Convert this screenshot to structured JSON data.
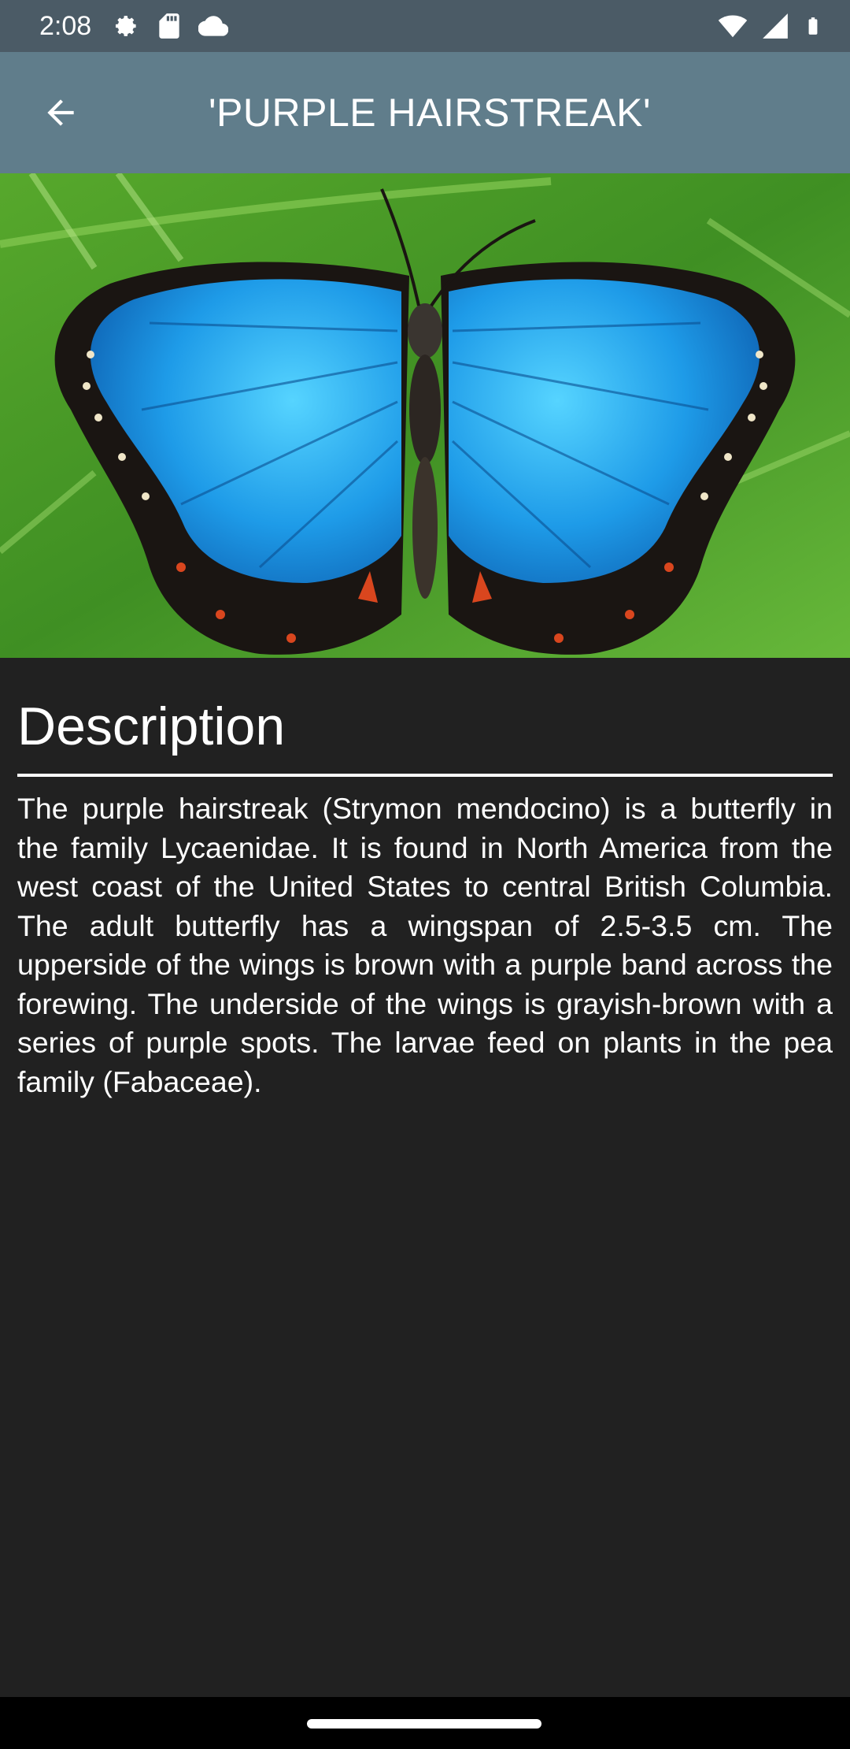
{
  "status_bar": {
    "time": "2:08",
    "left_icons": [
      "settings-icon",
      "sd-card-icon",
      "cloud-icon"
    ],
    "right_icons": [
      "wifi-icon",
      "signal-icon",
      "battery-icon"
    ]
  },
  "app_bar": {
    "back_icon": "arrow-back-icon",
    "title": "'PURPLE HAIRSTREAK'"
  },
  "hero_image": {
    "subject": "blue butterfly on green leaf",
    "colors": {
      "leaf": "#3f8f23",
      "wing": "#1e9be8",
      "wing_edge": "#1a1512"
    }
  },
  "content": {
    "section_title": "Description",
    "description": "The purple hairstreak (Strymon mendocino) is a butterfly in the family Lycaenidae. It is found in North America from the west coast of the United States to central British Columbia. The adult butterfly has a wingspan of 2.5-3.5 cm. The upperside of the wings is brown with a purple band across the forewing. The underside of the wings is grayish-brown with a series of purple spots. The larvae feed on plants in the pea family (Fabaceae)."
  },
  "colors": {
    "status_bar": "#4b5b66",
    "app_bar": "#607d8b",
    "background": "#212121",
    "text": "#ffffff"
  }
}
